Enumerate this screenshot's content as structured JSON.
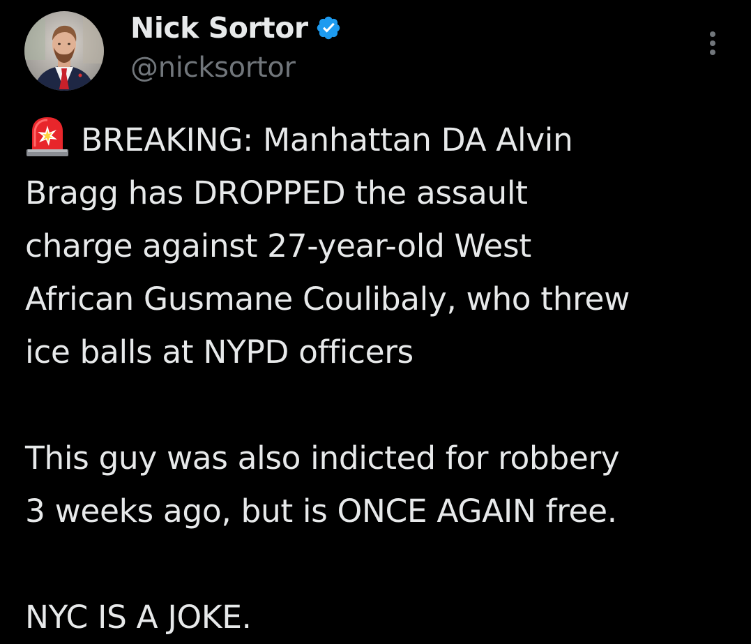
{
  "author": {
    "display_name": "Nick Sortor",
    "handle": "@nicksortor",
    "verified": true,
    "avatar_icon": "profile-photo-icon",
    "verified_icon": "verified-badge-icon"
  },
  "menu": {
    "icon": "more-options-icon"
  },
  "colors": {
    "background": "#000000",
    "text_primary": "#e7e9ea",
    "text_secondary": "#71767b",
    "verified_blue": "#1d9bf0"
  },
  "tweet": {
    "leading_emoji_icon": "rotating-light-icon",
    "paragraphs": [
      {
        "lines": [
          "BREAKING: Manhattan DA Alvin",
          "Bragg has DROPPED the assault",
          "charge against 27-year-old West",
          "African Gusmane Coulibaly, who threw",
          "ice balls at NYPD officers"
        ]
      },
      {
        "lines": [
          "This guy was also indicted for robbery",
          "3 weeks ago, but is ONCE AGAIN free."
        ]
      },
      {
        "lines": [
          "NYC IS A JOKE."
        ]
      }
    ]
  }
}
